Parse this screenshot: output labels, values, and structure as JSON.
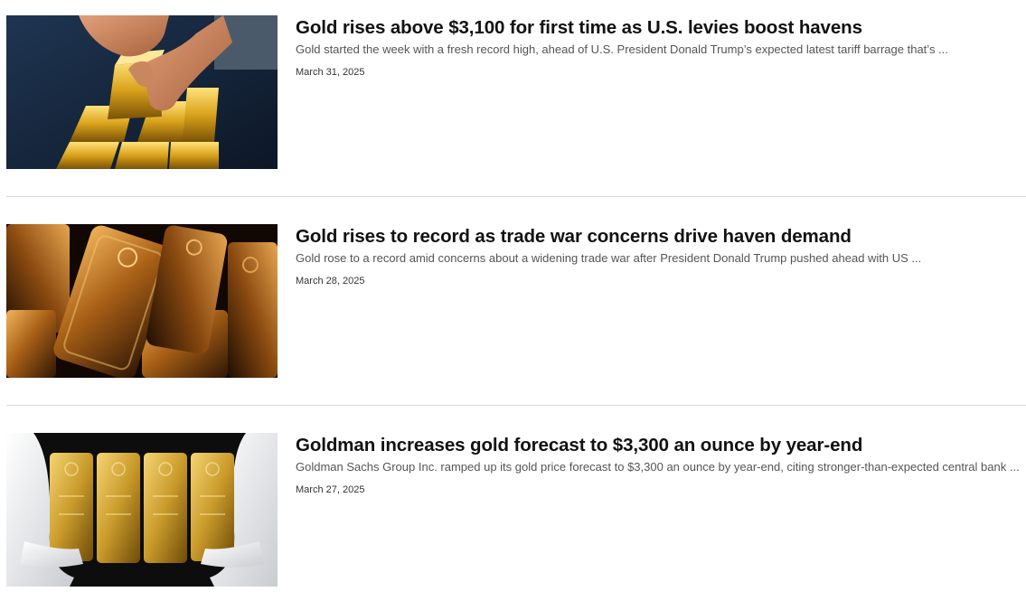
{
  "articles": [
    {
      "headline": "Gold rises above $3,100 for first time as U.S. levies boost havens",
      "summary": "Gold started the week with a fresh record high, ahead of U.S. President Donald Trump’s expected latest tariff barrage that’s ...",
      "date": "March 31, 2025",
      "image": "hands-stacking-gold-bars"
    },
    {
      "headline": "Gold rises to record as trade war concerns drive haven demand",
      "summary": "Gold rose to a record amid concerns about a widening trade war after President Donald Trump pushed ahead with US ...",
      "date": "March 28, 2025",
      "image": "stamped-gold-bars-dark"
    },
    {
      "headline": "Goldman increases gold forecast to $3,300 an ounce by year-end",
      "summary": "Goldman Sachs Group Inc. ramped up its gold price forecast to $3,300 an ounce by year-end, citing stronger-than-expected central bank ...",
      "date": "March 27, 2025",
      "image": "gloved-hands-holding-swiss-gold-bars"
    }
  ],
  "colors": {
    "headline": "#111111",
    "summary": "#555555",
    "date": "#333333",
    "divider": "#d9d9d9",
    "gold": "#d4a017"
  }
}
